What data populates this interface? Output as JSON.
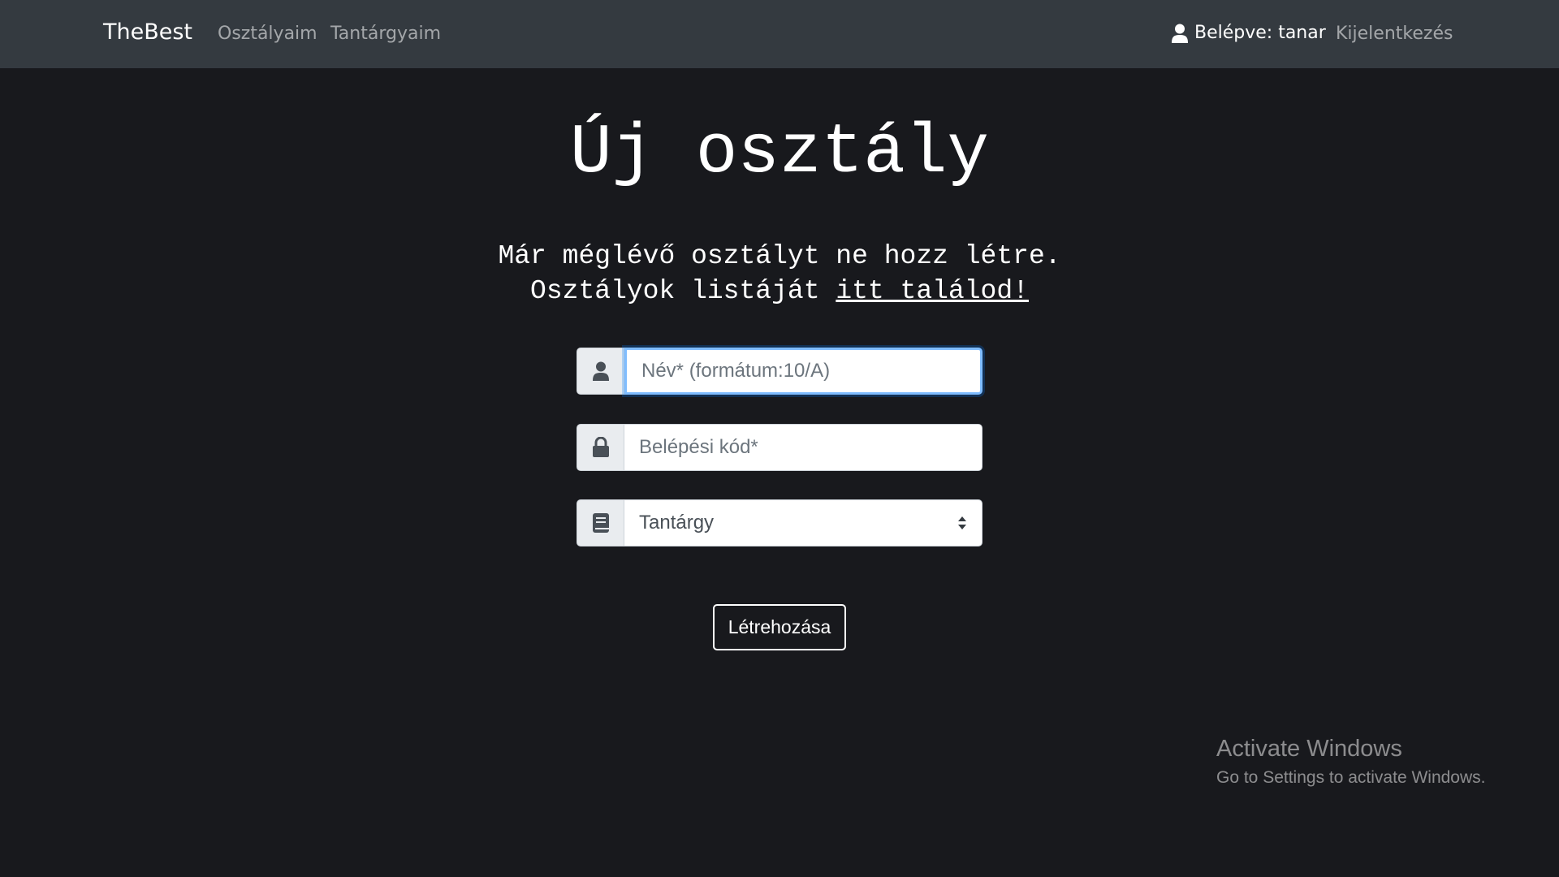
{
  "navbar": {
    "brand": "TheBest",
    "links": [
      "Osztályaim",
      "Tantárgyaim"
    ],
    "login_status": "Belépve: tanar",
    "logout": "Kijelentkezés"
  },
  "page": {
    "title": "Új osztály",
    "subtitle_line1": "Már méglévő osztályt ne hozz létre.",
    "subtitle_line2_prefix": "Osztályok listáját ",
    "subtitle_link": "itt találod!"
  },
  "form": {
    "name_placeholder": "Név* (formátum:10/A)",
    "name_value": "",
    "code_placeholder": "Belépési kód*",
    "code_value": "",
    "subject_selected": "Tantárgy",
    "submit_label": "Létrehozása",
    "icons": [
      "user-icon",
      "lock-icon",
      "book-icon"
    ]
  },
  "watermark": {
    "title": "Activate Windows",
    "subtitle": "Go to Settings to activate Windows."
  },
  "colors": {
    "navbar_bg": "#343a40",
    "page_bg": "#18191d",
    "focus_border": "#80bdff"
  }
}
